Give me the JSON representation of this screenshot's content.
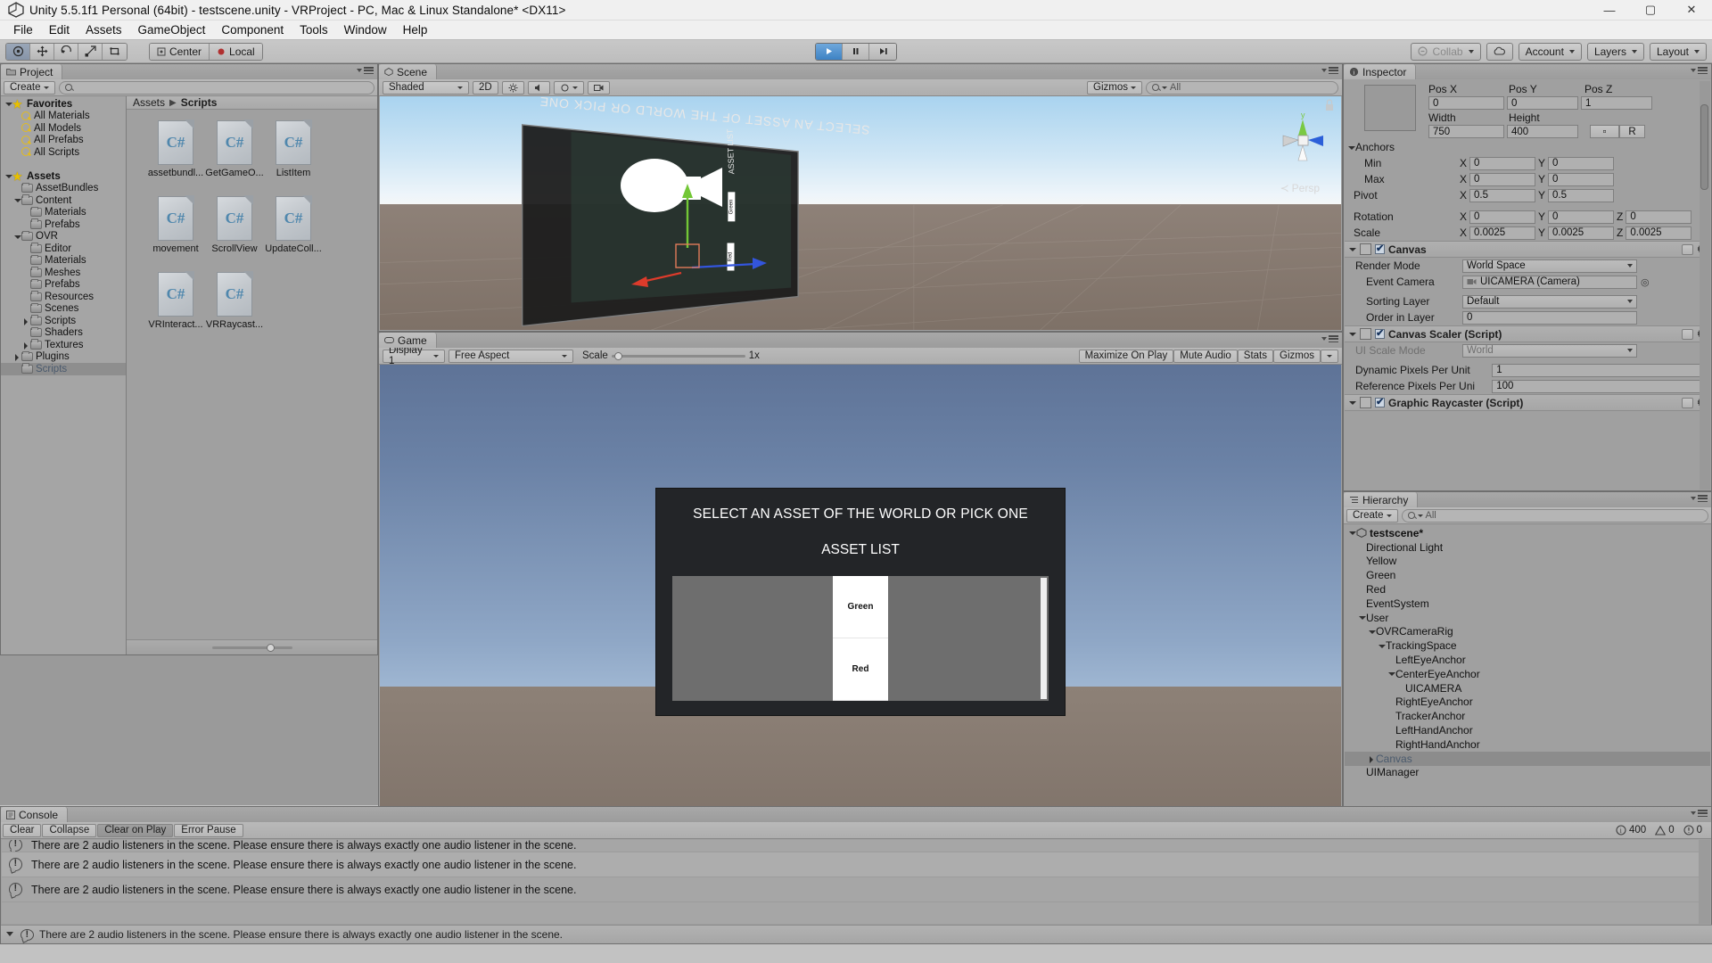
{
  "window": {
    "title": "Unity 5.5.1f1 Personal (64bit) - testscene.unity - VRProject - PC, Mac & Linux Standalone* <DX11>",
    "minimize": "—",
    "maximize": "▢",
    "close": "✕"
  },
  "menu": [
    "File",
    "Edit",
    "Assets",
    "GameObject",
    "Component",
    "Tools",
    "Window",
    "Help"
  ],
  "toolbar": {
    "tools": [
      "hand-tool",
      "move-tool",
      "rotate-tool",
      "scale-tool",
      "rect-tool"
    ],
    "pivot_mode": "Center",
    "pivot_rotation": "Local",
    "play": "▶",
    "pause": "❚❚",
    "step": "▶❙",
    "collab": "Collab",
    "cloud": "☁",
    "account": "Account",
    "layers": "Layers",
    "layout": "Layout"
  },
  "project": {
    "tab": "Project",
    "create_label": "Create",
    "search_placeholder": "",
    "tree": [
      {
        "label": "Favorites",
        "depth": 0,
        "icon": "star",
        "arrow": "down",
        "bold": true
      },
      {
        "label": "All Materials",
        "depth": 1,
        "icon": "search",
        "arrow": "none"
      },
      {
        "label": "All Models",
        "depth": 1,
        "icon": "search",
        "arrow": "none"
      },
      {
        "label": "All Prefabs",
        "depth": 1,
        "icon": "search",
        "arrow": "none"
      },
      {
        "label": "All Scripts",
        "depth": 1,
        "icon": "search",
        "arrow": "none"
      },
      {
        "label": "",
        "depth": 0,
        "icon": "none",
        "arrow": "none"
      },
      {
        "label": "Assets",
        "depth": 0,
        "icon": "star",
        "arrow": "down",
        "bold": true
      },
      {
        "label": "AssetBundles",
        "depth": 1,
        "icon": "folder",
        "arrow": "none"
      },
      {
        "label": "Content",
        "depth": 1,
        "icon": "folder",
        "arrow": "down"
      },
      {
        "label": "Materials",
        "depth": 2,
        "icon": "folder",
        "arrow": "none"
      },
      {
        "label": "Prefabs",
        "depth": 2,
        "icon": "folder",
        "arrow": "none"
      },
      {
        "label": "OVR",
        "depth": 1,
        "icon": "folder",
        "arrow": "down"
      },
      {
        "label": "Editor",
        "depth": 2,
        "icon": "folder",
        "arrow": "none"
      },
      {
        "label": "Materials",
        "depth": 2,
        "icon": "folder",
        "arrow": "none"
      },
      {
        "label": "Meshes",
        "depth": 2,
        "icon": "folder",
        "arrow": "none"
      },
      {
        "label": "Prefabs",
        "depth": 2,
        "icon": "folder",
        "arrow": "none"
      },
      {
        "label": "Resources",
        "depth": 2,
        "icon": "folder",
        "arrow": "none"
      },
      {
        "label": "Scenes",
        "depth": 2,
        "icon": "folder",
        "arrow": "none"
      },
      {
        "label": "Scripts",
        "depth": 2,
        "icon": "folder",
        "arrow": "right"
      },
      {
        "label": "Shaders",
        "depth": 2,
        "icon": "folder",
        "arrow": "none"
      },
      {
        "label": "Textures",
        "depth": 2,
        "icon": "folder",
        "arrow": "right"
      },
      {
        "label": "Plugins",
        "depth": 1,
        "icon": "folder",
        "arrow": "right"
      },
      {
        "label": "Scripts",
        "depth": 1,
        "icon": "folder",
        "arrow": "none",
        "selected": true
      }
    ],
    "breadcrumb": [
      "Assets",
      "Scripts"
    ],
    "assets": [
      {
        "name": "assetbundl...",
        "type": "C#"
      },
      {
        "name": "GetGameO...",
        "type": "C#"
      },
      {
        "name": "ListItem",
        "type": "C#"
      },
      {
        "name": "movement",
        "type": "C#"
      },
      {
        "name": "ScrollView",
        "type": "C#"
      },
      {
        "name": "UpdateColl...",
        "type": "C#"
      },
      {
        "name": "VRInteract...",
        "type": "C#"
      },
      {
        "name": "VRRaycast...",
        "type": "C#"
      }
    ]
  },
  "scene": {
    "tab": "Scene",
    "shading": "Shaded",
    "mode_2d": "2D",
    "gizmos": "Gizmos",
    "search_placeholder": "All",
    "persp_label": "Persp",
    "axis_y": "y",
    "overlay_text_1": "SELECT AN ASSET OF THE WORLD OR PICK ONE",
    "overlay_text_2": "ASSET LIST",
    "overlay_item_1": "Green",
    "overlay_item_2": "Red"
  },
  "game": {
    "tab": "Game",
    "display": "Display 1",
    "aspect": "Free Aspect",
    "scale_label": "Scale",
    "scale_value": "1x",
    "maximize_on_play": "Maximize On Play",
    "mute_audio": "Mute Audio",
    "stats": "Stats",
    "gizmos": "Gizmos",
    "ui": {
      "title": "SELECT AN ASSET OF THE WORLD OR PICK ONE",
      "subtitle": "ASSET LIST",
      "items": [
        "Green",
        "Red"
      ]
    }
  },
  "inspector": {
    "tab": "Inspector",
    "rect_transform": {
      "pos_x_label": "Pos X",
      "pos_x": "0",
      "pos_y_label": "Pos Y",
      "pos_y": "0",
      "pos_z_label": "Pos Z",
      "pos_z": "1",
      "width_label": "Width",
      "width": "750",
      "height_label": "Height",
      "height": "400",
      "blueprint_btn": "▫",
      "raw_btn": "R",
      "anchors_label": "Anchors",
      "min_label": "Min",
      "min_x": "0",
      "min_y": "0",
      "max_label": "Max",
      "max_x": "0",
      "max_y": "0",
      "pivot_label": "Pivot",
      "pivot_x": "0.5",
      "pivot_y": "0.5",
      "rotation_label": "Rotation",
      "rot_x": "0",
      "rot_y": "0",
      "rot_z": "0",
      "scale_label": "Scale",
      "scale_x": "0.0025",
      "scale_y": "0.0025",
      "scale_z": "0.0025",
      "axis_x": "X",
      "axis_y": "Y",
      "axis_z": "Z"
    },
    "canvas": {
      "title": "Canvas",
      "render_mode_label": "Render Mode",
      "render_mode": "World Space",
      "event_camera_label": "Event Camera",
      "event_camera": "UICAMERA (Camera)",
      "sorting_layer_label": "Sorting Layer",
      "sorting_layer": "Default",
      "order_in_layer_label": "Order in Layer",
      "order_in_layer": "0"
    },
    "canvas_scaler": {
      "title": "Canvas Scaler (Script)",
      "ui_scale_mode_label": "UI Scale Mode",
      "ui_scale_mode": "World",
      "dynamic_ppu_label": "Dynamic Pixels Per Unit",
      "dynamic_ppu": "1",
      "reference_ppu_label": "Reference Pixels Per Uni",
      "reference_ppu": "100"
    },
    "graphic_raycaster": {
      "title": "Graphic Raycaster (Script)"
    }
  },
  "hierarchy": {
    "tab": "Hierarchy",
    "create_label": "Create",
    "search_placeholder": "All",
    "items": [
      {
        "label": "testscene*",
        "depth": 0,
        "arrow": "down",
        "icon": "unity",
        "bold": true
      },
      {
        "label": "Directional Light",
        "depth": 1,
        "arrow": "none"
      },
      {
        "label": "Yellow",
        "depth": 1,
        "arrow": "none"
      },
      {
        "label": "Green",
        "depth": 1,
        "arrow": "none"
      },
      {
        "label": "Red",
        "depth": 1,
        "arrow": "none"
      },
      {
        "label": "EventSystem",
        "depth": 1,
        "arrow": "none"
      },
      {
        "label": "User",
        "depth": 1,
        "arrow": "down"
      },
      {
        "label": "OVRCameraRig",
        "depth": 2,
        "arrow": "down"
      },
      {
        "label": "TrackingSpace",
        "depth": 3,
        "arrow": "down"
      },
      {
        "label": "LeftEyeAnchor",
        "depth": 4,
        "arrow": "none"
      },
      {
        "label": "CenterEyeAnchor",
        "depth": 4,
        "arrow": "down"
      },
      {
        "label": "UICAMERA",
        "depth": 5,
        "arrow": "none"
      },
      {
        "label": "RightEyeAnchor",
        "depth": 4,
        "arrow": "none"
      },
      {
        "label": "TrackerAnchor",
        "depth": 4,
        "arrow": "none"
      },
      {
        "label": "LeftHandAnchor",
        "depth": 4,
        "arrow": "none"
      },
      {
        "label": "RightHandAnchor",
        "depth": 4,
        "arrow": "none"
      },
      {
        "label": "Canvas",
        "depth": 2,
        "arrow": "right",
        "selected": true
      },
      {
        "label": "UIManager",
        "depth": 1,
        "arrow": "none"
      }
    ]
  },
  "console": {
    "tab": "Console",
    "buttons": [
      {
        "label": "Clear",
        "pressed": false
      },
      {
        "label": "Collapse",
        "pressed": false
      },
      {
        "label": "Clear on Play",
        "pressed": true
      },
      {
        "label": "Error Pause",
        "pressed": false
      }
    ],
    "counts": {
      "info": "400",
      "warning": "0",
      "error": "0"
    },
    "messages": [
      "There are 2 audio listeners in the scene. Please ensure there is always exactly one audio listener in the scene.",
      "There are 2 audio listeners in the scene. Please ensure there is always exactly one audio listener in the scene.",
      "There are 2 audio listeners in the scene. Please ensure there is always exactly one audio listener in the scene."
    ],
    "status": "There are 2 audio listeners in the scene. Please ensure there is always exactly one audio listener in the scene."
  },
  "colors": {
    "panel_bg": "#a0a0a0",
    "toolbar_bg": "#c0c0c0",
    "accent_blue": "#3d82c4",
    "selection": "#5a6e84",
    "vr_panel_bg": "#232528"
  }
}
